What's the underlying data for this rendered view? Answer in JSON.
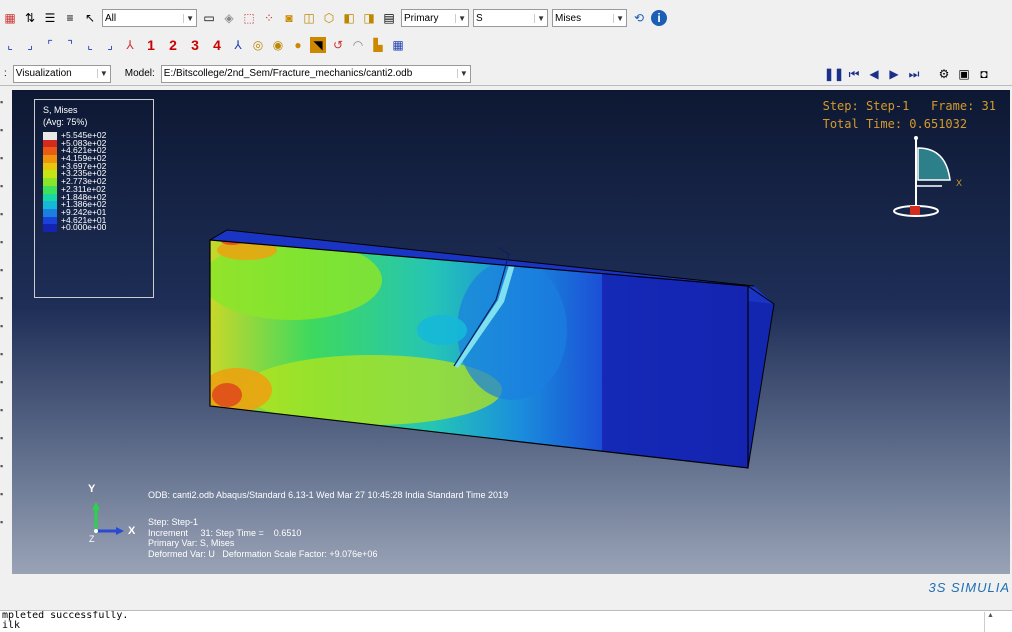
{
  "toolbar1": {
    "selection_filter": "All",
    "primary_select": "Primary",
    "variable_select": "S",
    "invariant_select": "Mises",
    "info_icon": "info-icon"
  },
  "toolbar2": {
    "view_numbers": [
      "1",
      "2",
      "3",
      "4"
    ]
  },
  "toolbar3": {
    "module_select": "Visualization",
    "model_label": "Model:",
    "model_path": "E:/Bitscollege/2nd_Sem/Fracture_mechanics/canti2.odb"
  },
  "legend": {
    "title_line1": "S, Mises",
    "title_line2": "(Avg: 75%)",
    "entries": [
      {
        "label": "+5.545e+02",
        "color": "#e8e8e8"
      },
      {
        "label": "+5.083e+02",
        "color": "#d42b1f"
      },
      {
        "label": "+4.621e+02",
        "color": "#e85a16"
      },
      {
        "label": "+4.159e+02",
        "color": "#f0930f"
      },
      {
        "label": "+3.697e+02",
        "color": "#e7c60f"
      },
      {
        "label": "+3.235e+02",
        "color": "#c7e515"
      },
      {
        "label": "+2.773e+02",
        "color": "#8ae52a"
      },
      {
        "label": "+2.311e+02",
        "color": "#3ee05c"
      },
      {
        "label": "+1.848e+02",
        "color": "#18d6a6"
      },
      {
        "label": "+1.386e+02",
        "color": "#16b8d8"
      },
      {
        "label": "+9.242e+01",
        "color": "#1b7fe0"
      },
      {
        "label": "+4.621e+01",
        "color": "#1942d8"
      },
      {
        "label": "+0.000e+00",
        "color": "#1423b0"
      }
    ]
  },
  "step_info": {
    "line1": "Step: Step-1   Frame: 31",
    "line2": "Total Time: 0.651032"
  },
  "triad": {
    "x_label": "X",
    "y_label": "Y",
    "z_label": "Z"
  },
  "mini_triad": {
    "x_label": "X"
  },
  "odb_line": "ODB: canti2.odb    Abaqus/Standard 6.13-1    Wed Mar 27 10:45:28 India Standard Time 2019",
  "step_block": {
    "line1": "Step: Step-1",
    "line2": "Increment     31: Step Time =    0.6510",
    "line3": "Primary Var: S, Mises",
    "line4": "Deformed Var: U   Deformation Scale Factor: +9.076e+06"
  },
  "brand": "3S SIMULIA",
  "messages": {
    "line1": "mpleted successfully.",
    "line2": "ilk"
  },
  "colors": {
    "step_text": "#d59a2a",
    "brand": "#1f6fb4"
  }
}
